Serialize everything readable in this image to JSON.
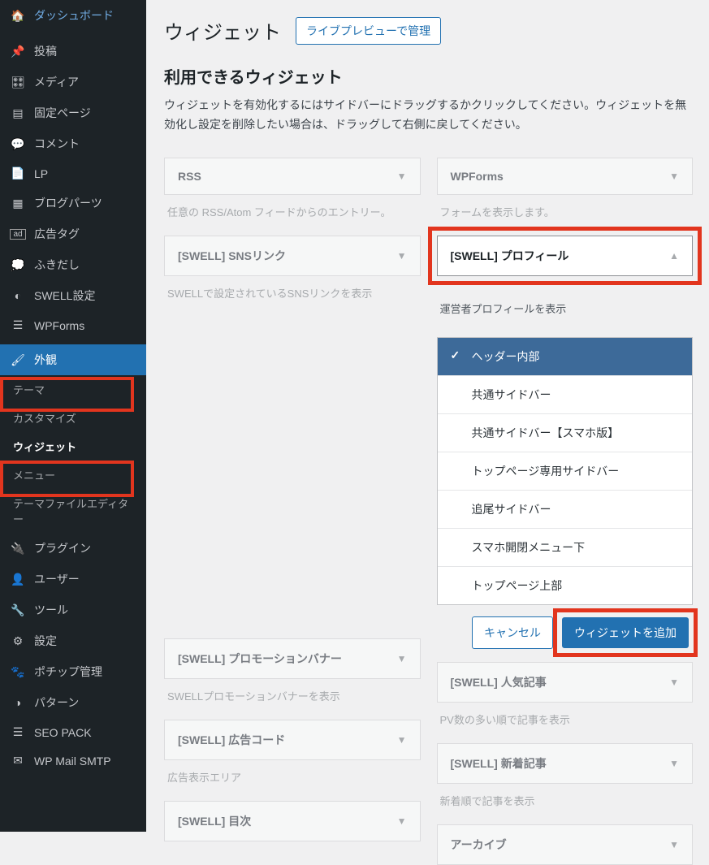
{
  "sidebar": {
    "items": [
      {
        "label": "ダッシュボード",
        "icon": "dash"
      },
      {
        "label": "投稿",
        "icon": "pin"
      },
      {
        "label": "メディア",
        "icon": "media"
      },
      {
        "label": "固定ページ",
        "icon": "page"
      },
      {
        "label": "コメント",
        "icon": "comment"
      },
      {
        "label": "LP",
        "icon": "file"
      },
      {
        "label": "ブログパーツ",
        "icon": "grid"
      },
      {
        "label": "広告タグ",
        "icon": "ad"
      },
      {
        "label": "ふきだし",
        "icon": "chat"
      },
      {
        "label": "SWELL設定",
        "icon": "swell"
      },
      {
        "label": "WPForms",
        "icon": "form"
      },
      {
        "label": "外観",
        "icon": "brush",
        "current": true
      },
      {
        "label": "プラグイン",
        "icon": "plug"
      },
      {
        "label": "ユーザー",
        "icon": "user"
      },
      {
        "label": "ツール",
        "icon": "tool"
      },
      {
        "label": "設定",
        "icon": "settings"
      },
      {
        "label": "ポチップ管理",
        "icon": "paw"
      },
      {
        "label": "パターン",
        "icon": "pattern"
      },
      {
        "label": "SEO PACK",
        "icon": "list"
      },
      {
        "label": "WP Mail SMTP",
        "icon": "mail"
      }
    ],
    "submenu": [
      {
        "label": "テーマ"
      },
      {
        "label": "カスタマイズ"
      },
      {
        "label": "ウィジェット",
        "current": true
      },
      {
        "label": "メニュー"
      },
      {
        "label": "テーマファイルエディター"
      }
    ]
  },
  "page": {
    "title": "ウィジェット",
    "preview_button": "ライブプレビューで管理",
    "subtitle": "利用できるウィジェット",
    "help": "ウィジェットを有効化するにはサイドバーにドラッグするかクリックしてください。ウィジェットを無効化し設定を削除したい場合は、ドラッグして右側に戻してください。"
  },
  "widgets": {
    "left": [
      {
        "title": "RSS",
        "desc": "任意の RSS/Atom フィードからのエントリー。"
      },
      {
        "title": "[SWELL] SNSリンク",
        "desc": "SWELLで設定されているSNSリンクを表示"
      },
      {
        "title": "[SWELL] プロモーションバナー",
        "desc": "SWELLプロモーションバナーを表示"
      },
      {
        "title": "[SWELL] 広告コード",
        "desc": "広告表示エリア"
      },
      {
        "title": "[SWELL] 目次",
        "desc": ""
      }
    ],
    "right": [
      {
        "title": "WPForms",
        "desc": "フォームを表示します。"
      },
      {
        "title": "[SWELL] プロフィール",
        "desc": "運営者プロフィールを表示",
        "open": true
      },
      {
        "title": "[SWELL] 人気記事",
        "desc": "PV数の多い順で記事を表示"
      },
      {
        "title": "[SWELL] 新着記事",
        "desc": "新着順で記事を表示"
      },
      {
        "title": "アーカイブ",
        "desc": ""
      }
    ]
  },
  "areas": [
    {
      "label": "ヘッダー内部",
      "selected": true
    },
    {
      "label": "共通サイドバー"
    },
    {
      "label": "共通サイドバー【スマホ版】"
    },
    {
      "label": "トップページ専用サイドバー"
    },
    {
      "label": "追尾サイドバー"
    },
    {
      "label": "スマホ開閉メニュー下"
    },
    {
      "label": "トップページ上部"
    }
  ],
  "actions": {
    "cancel": "キャンセル",
    "add": "ウィジェットを追加"
  }
}
